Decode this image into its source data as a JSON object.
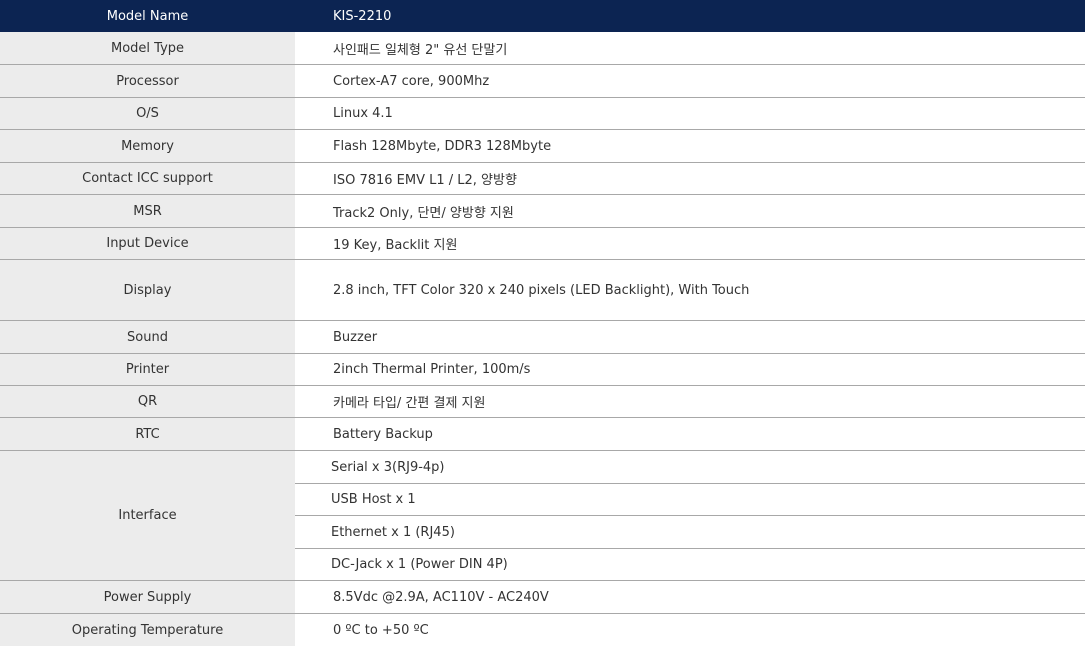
{
  "header": {
    "label": "Model Name",
    "value": "KIS-2210"
  },
  "rows": [
    {
      "label": "Model Type",
      "value": "사인패드 일체형 2\" 유선 단말기"
    },
    {
      "label": "Processor",
      "value": "Cortex-A7 core, 900Mhz"
    },
    {
      "label": "O/S",
      "value": "Linux 4.1"
    },
    {
      "label": "Memory",
      "value": "Flash 128Mbyte, DDR3 128Mbyte"
    },
    {
      "label": "Contact ICC support",
      "value": "ISO 7816 EMV L1 / L2, 양방향"
    },
    {
      "label": "MSR",
      "value": "Track2 Only, 단면/ 양방향 지원"
    },
    {
      "label": "Input Device",
      "value": "19 Key, Backlit 지원"
    },
    {
      "label": "Display",
      "value": "2.8 inch, TFT Color 320 x 240 pixels (LED Backlight), With Touch"
    },
    {
      "label": "Sound",
      "value": "Buzzer"
    },
    {
      "label": "Printer",
      "value": "2inch Thermal Printer, 100m/s"
    },
    {
      "label": "QR",
      "value": "카메라 타입/ 간편 결제 지원"
    },
    {
      "label": "RTC",
      "value": "Battery Backup"
    }
  ],
  "interface": {
    "label": "Interface",
    "values": [
      "Serial x 3(RJ9-4p)",
      "USB Host x 1",
      "Ethernet x 1 (RJ45)",
      "DC-Jack  x 1 (Power DIN  4P)"
    ]
  },
  "tail_rows": [
    {
      "label": "Power Supply",
      "value": "8.5Vdc @2.9A,  AC110V - AC240V"
    },
    {
      "label": "Operating Temperature",
      "value": "0 ºC to +50 ºC"
    }
  ],
  "colors": {
    "header_bg": "#0c2452",
    "label_bg": "#ececec",
    "divider": "#a8a8a8"
  }
}
